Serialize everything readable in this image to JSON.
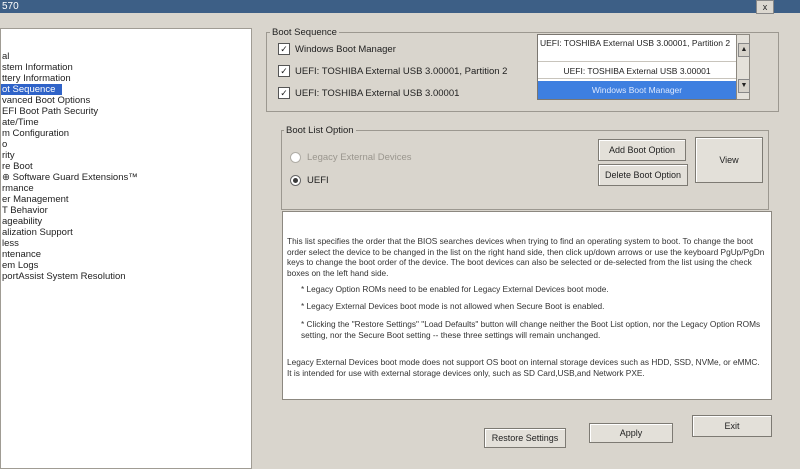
{
  "window": {
    "title": "570",
    "close_label": "x"
  },
  "sidebar": {
    "items": [
      {
        "label": "al"
      },
      {
        "label": "stem Information"
      },
      {
        "label": "ttery Information"
      },
      {
        "label": "ot Sequence",
        "selected": true
      },
      {
        "label": "vanced Boot Options"
      },
      {
        "label": "EFI Boot Path Security"
      },
      {
        "label": "ate/Time"
      },
      {
        "label": "m Configuration"
      },
      {
        "label": "o"
      },
      {
        "label": "rity"
      },
      {
        "label": "re Boot"
      },
      {
        "label": "Software Guard Extensions™"
      },
      {
        "label": "rmance"
      },
      {
        "label": "er Management"
      },
      {
        "label": "T Behavior"
      },
      {
        "label": "ageability"
      },
      {
        "label": "alization Support"
      },
      {
        "label": "less"
      },
      {
        "label": "ntenance"
      },
      {
        "label": "em Logs"
      },
      {
        "label": "portAssist System Resolution"
      }
    ]
  },
  "boot_sequence": {
    "group_label": "Boot Sequence",
    "entries": [
      {
        "label": "Windows Boot Manager",
        "checked": true
      },
      {
        "label": "UEFI: TOSHIBA External USB 3.00001, Partition 2",
        "checked": true
      },
      {
        "label": "UEFI: TOSHIBA External USB 3.00001",
        "checked": true
      }
    ],
    "order_list": [
      {
        "label": "UEFI: TOSHIBA External USB 3.00001, Partition 2",
        "selected": false
      },
      {
        "label": "UEFI: TOSHIBA External USB 3.00001",
        "selected": false
      },
      {
        "label": "Windows Boot Manager",
        "selected": true
      }
    ],
    "scroll_up": "▲",
    "scroll_down": "▼"
  },
  "boot_list_option": {
    "group_label": "Boot List Option",
    "options": [
      {
        "label": "Legacy External Devices",
        "selected": false,
        "disabled": true
      },
      {
        "label": "UEFI",
        "selected": true,
        "disabled": false
      }
    ],
    "add_button": "Add Boot Option",
    "delete_button": "Delete Boot Option",
    "view_button": "View"
  },
  "info": {
    "intro": "This list specifies the order that the BIOS searches devices when trying to find an operating system to boot. To change the boot order select the device to be changed in the list on the right hand side, then click up/down arrows or use the keyboard PgUp/PgDn keys to change the boot order of the device. The boot devices can also be selected or de-selected from the list using the check boxes on the left hand side.",
    "bullet1": "* Legacy Option ROMs need to be enabled for Legacy External Devices boot mode.",
    "bullet2": "* Legacy External Devices boot mode is not allowed when Secure Boot is enabled.",
    "bullet3": "* Clicking the \"Restore Settings\" \"Load Defaults\" button will change neither the Boot List option, nor the Legacy Option ROMs setting, nor the Secure Boot setting -- these three settings will remain unchanged.",
    "footer": "Legacy External Devices boot mode does not support OS boot on internal storage devices such as HDD, SSD, NVMe, or eMMC. It is intended for use with external storage devices only, such as SD Card,USB,and Network PXE."
  },
  "footer_buttons": {
    "restore": "Restore Settings",
    "apply": "Apply",
    "exit": "Exit"
  }
}
